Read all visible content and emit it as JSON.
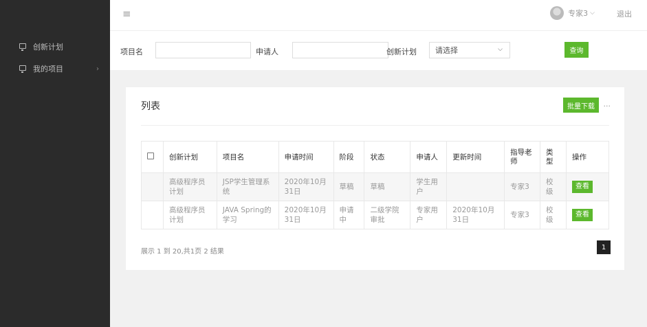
{
  "sidebar": {
    "items": [
      {
        "label": "创新计划",
        "icon": "monitor-icon"
      },
      {
        "label": "我的项目",
        "icon": "monitor-icon",
        "chevron": "›"
      }
    ]
  },
  "topbar": {
    "menu_icon": "≡",
    "user_name": "专家3",
    "user_caret": "⌵",
    "logout": "退出"
  },
  "filters": {
    "project_label": "项目名",
    "project_value": "",
    "applicant_label": "申请人",
    "applicant_value": "",
    "plan_label": "创新计划",
    "plan_selected": "请选择",
    "plan_arrow": "⌵",
    "query_button": "查询"
  },
  "panel": {
    "title": "列表",
    "batch_download": "批量下载",
    "more": "...",
    "columns": [
      "创新计划",
      "项目名",
      "申请时间",
      "阶段",
      "状态",
      "申请人",
      "更新时间",
      "指导老师",
      "类型",
      "操作"
    ],
    "rows": [
      {
        "plan": "高级程序员计划",
        "project": "JSP学生管理系统",
        "apply_time": "2020年10月31日",
        "stage": "草稿",
        "status": "草稿",
        "applicant": "学生用户",
        "update_time": "",
        "advisor": "专家3",
        "type": "校级",
        "action": "查看"
      },
      {
        "plan": "高级程序员计划",
        "project": "JAVA Spring的学习",
        "apply_time": "2020年10月31日",
        "stage": "申请中",
        "status": "二级学院审批",
        "applicant": "专家用户",
        "update_time": "2020年10月31日",
        "advisor": "专家3",
        "type": "校级",
        "action": "查看"
      }
    ],
    "page_info": "展示 1 到 20,共1页 2 结果",
    "current_page": "1"
  },
  "colors": {
    "sidebar_bg": "#2b2b2b",
    "accent_green": "#5cb82d",
    "pager_bg": "#222222"
  }
}
